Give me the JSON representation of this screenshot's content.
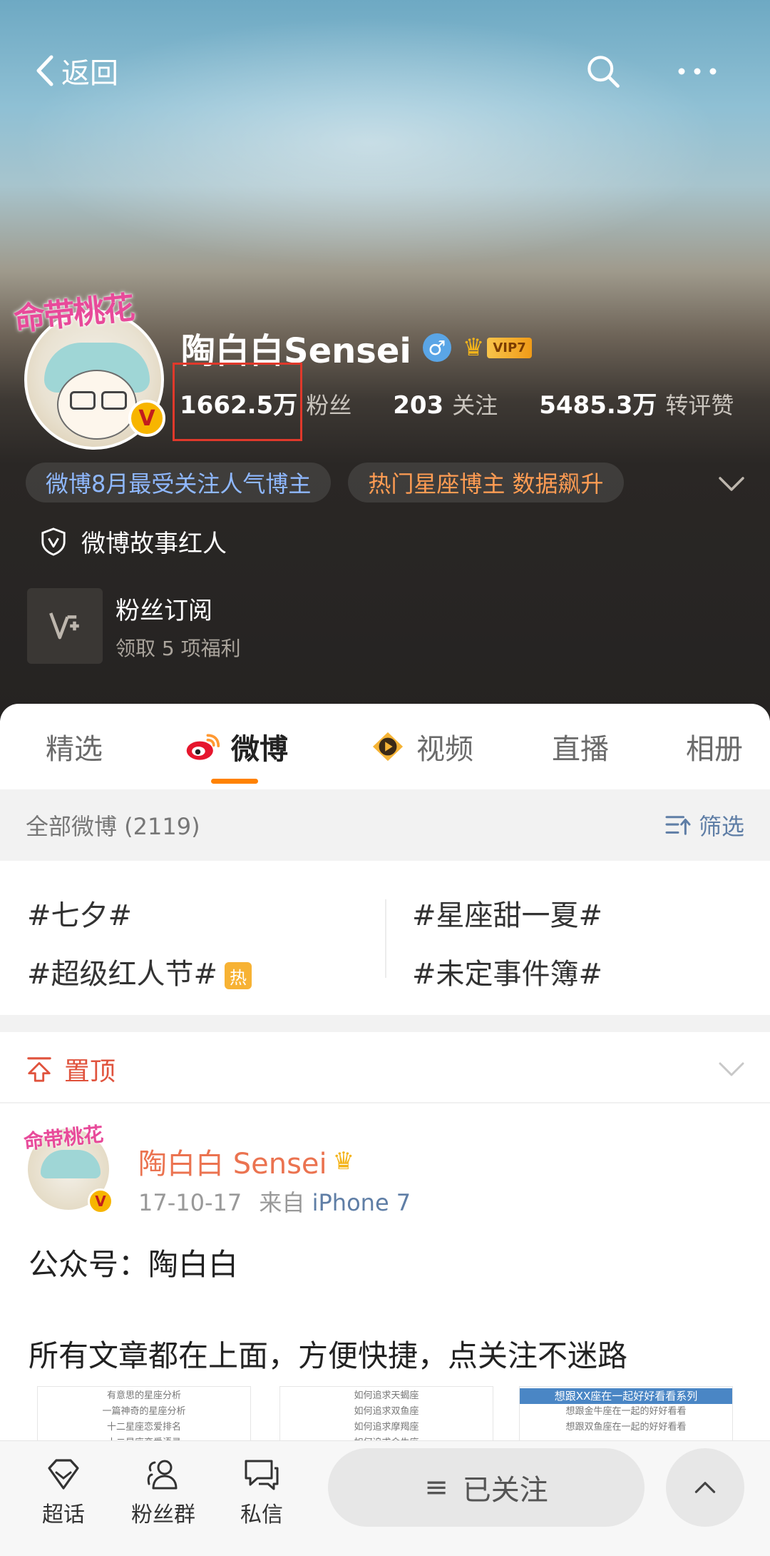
{
  "header": {
    "back_label": "返回",
    "search_icon": "search-icon",
    "more_icon": "more-icon"
  },
  "profile": {
    "avatar_frame_text": "命带桃花",
    "verified_badge": "V",
    "name": "陶白白Sensei",
    "gender_symbol": "♂",
    "vip_label": "VIP7",
    "stats": [
      {
        "value": "1662.5万",
        "label": "粉丝"
      },
      {
        "value": "203",
        "label": "关注"
      },
      {
        "value": "5485.3万",
        "label": "转评赞"
      }
    ],
    "chips": [
      {
        "text": "微博8月最受关注人气博主",
        "color": "#8fb8ff"
      },
      {
        "text": "热门星座博主 数据飙升",
        "color": "#ff9c53"
      }
    ],
    "story_label": "微博故事红人",
    "fan_sub": {
      "title": "粉丝订阅",
      "subtitle": "领取 5 项福利"
    }
  },
  "tabs": [
    {
      "label": "精选"
    },
    {
      "label": "微博"
    },
    {
      "label": "视频"
    },
    {
      "label": "直播"
    },
    {
      "label": "相册"
    }
  ],
  "filter": {
    "all_label": "全部微博 (2119)",
    "filter_label": "筛选"
  },
  "topics": [
    {
      "text": "#七夕#"
    },
    {
      "text": "#星座甜一夏#"
    },
    {
      "text": "#超级红人节#",
      "badge": "热"
    },
    {
      "text": "#未定事件簿#"
    }
  ],
  "pinned": {
    "label": "置顶"
  },
  "post": {
    "avatar_frame_text": "命带桃花",
    "verified_badge": "V",
    "author": "陶白白 Sensei",
    "date": "17-10-17",
    "from_label": "来自",
    "source": "iPhone 7",
    "line1": "公众号：陶白白",
    "line2": "所有文章都在上面，方便快捷，点关注不迷路",
    "thumb1": [
      "有意思的星座分析",
      "一篇神奇的星座分析",
      "十二星座恋爱排名",
      "十二星座恋爱语录"
    ],
    "thumb2": [
      "如何追求天蝎座",
      "如何追求双鱼座",
      "如何追求摩羯座",
      "如何追求金牛座"
    ],
    "thumb3": {
      "head": "想跟XX座在一起好好看看系列",
      "lines": [
        "想跟金牛座在一起的好好看看",
        "想跟双鱼座在一起的好好看看"
      ]
    }
  },
  "bottombar": {
    "items": [
      {
        "label": "超话"
      },
      {
        "label": "粉丝群"
      },
      {
        "label": "私信"
      }
    ],
    "follow_label": "已关注",
    "follow_icon": "≡"
  },
  "colors": {
    "accent_orange": "#ff8200",
    "link_blue": "#5f7ea6",
    "pinned_red": "#e0533d",
    "highlight_box": "#e0392b"
  }
}
